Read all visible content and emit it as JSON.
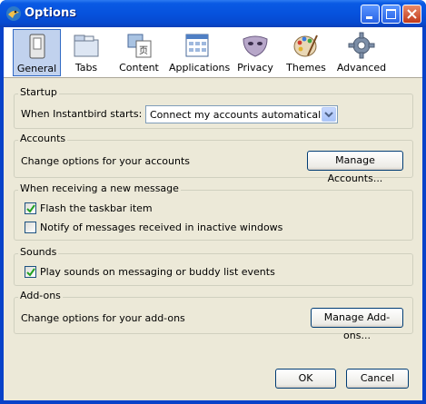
{
  "window": {
    "title": "Options"
  },
  "tabs": [
    {
      "label": "General",
      "icon": "general-icon",
      "selected": true
    },
    {
      "label": "Tabs",
      "icon": "tabs-icon"
    },
    {
      "label": "Content",
      "icon": "content-icon"
    },
    {
      "label": "Applications",
      "icon": "applications-icon"
    },
    {
      "label": "Privacy",
      "icon": "privacy-mask-icon"
    },
    {
      "label": "Themes",
      "icon": "themes-palette-icon"
    },
    {
      "label": "Advanced",
      "icon": "gear-icon"
    }
  ],
  "startup": {
    "title": "Startup",
    "label": "When Instantbird starts:",
    "select_value": "Connect my accounts automatically"
  },
  "accounts": {
    "title": "Accounts",
    "text": "Change options for your accounts",
    "button": "Manage Accounts..."
  },
  "newmsg": {
    "title": "When receiving a new message",
    "flash": {
      "label": "Flash the taskbar item",
      "checked": true
    },
    "notify": {
      "label": "Notify of messages received in inactive windows",
      "checked": false
    }
  },
  "sounds": {
    "title": "Sounds",
    "play": {
      "label": "Play sounds on messaging or buddy list events",
      "checked": true
    }
  },
  "addons": {
    "title": "Add-ons",
    "text": "Change options for your add-ons",
    "button": "Manage Add-ons..."
  },
  "footer": {
    "ok": "OK",
    "cancel": "Cancel"
  },
  "colors": {
    "titlebar": "#0652dd",
    "dialog": "#ece9d8",
    "selected_tab": "#c1d2ee"
  }
}
